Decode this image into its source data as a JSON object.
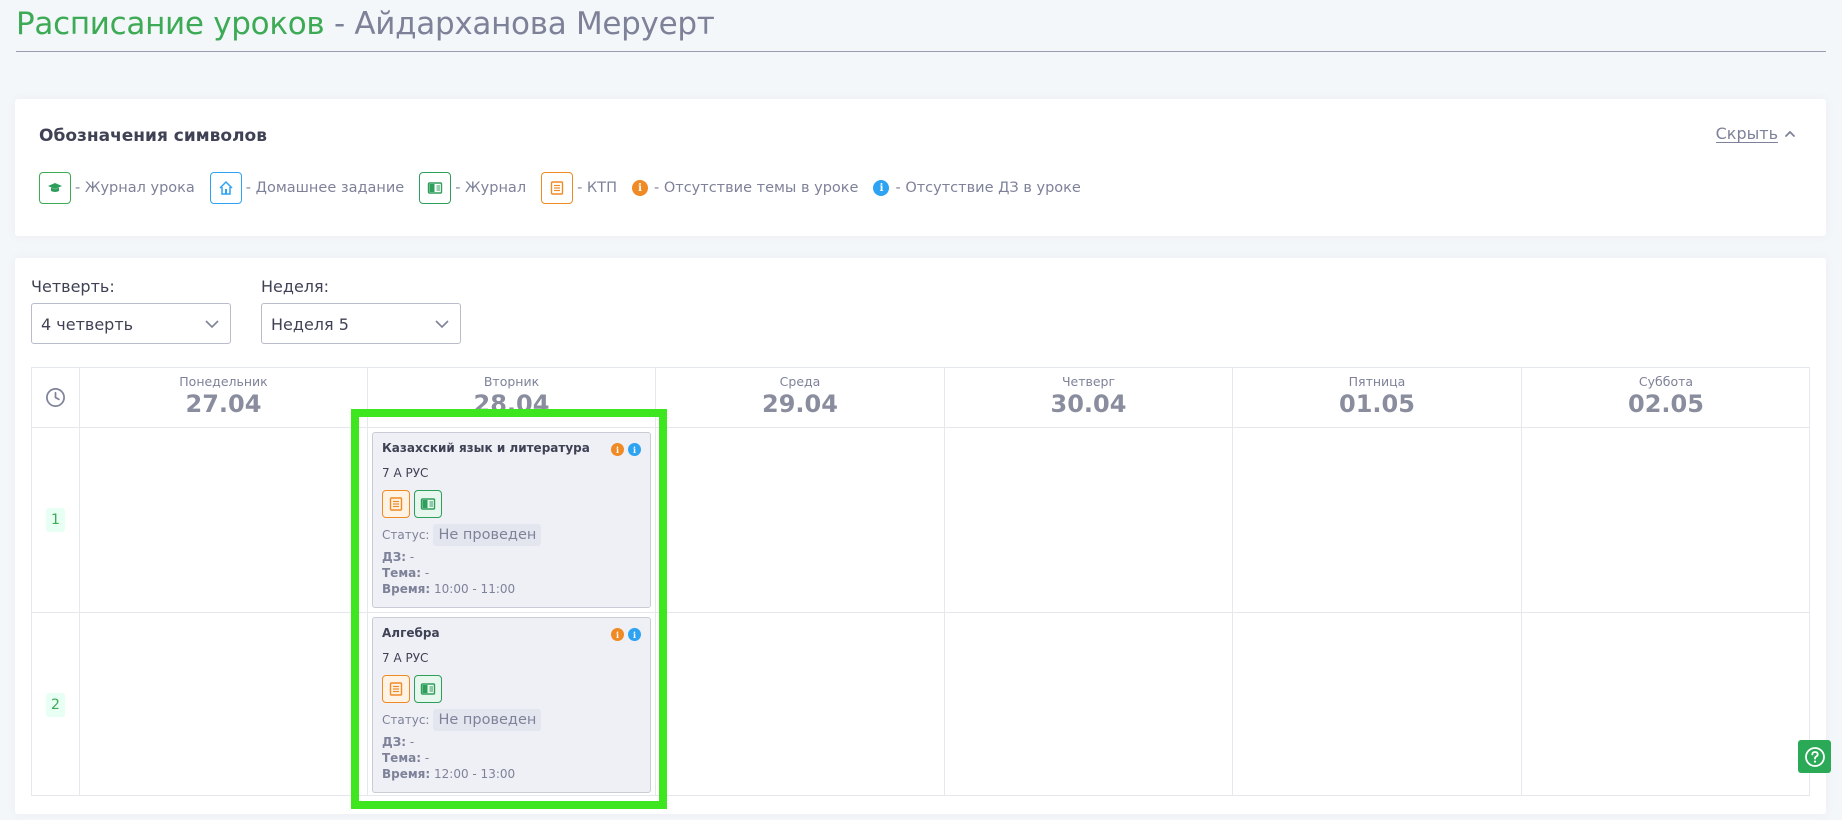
{
  "page": {
    "title_main": "Расписание уроков",
    "title_rest": " - Айдарханова Меруерт"
  },
  "legend": {
    "title": "Обозначения символов",
    "hide_label": "Скрыть",
    "items": {
      "lesson_journal": "- Журнал урока",
      "homework": "- Домашнее задание",
      "journal": "- Журнал",
      "ktp": "- КТП",
      "no_topic": "- Отсутствие темы в уроке",
      "no_hw": "- Отсутствие ДЗ в уроке"
    }
  },
  "filters": {
    "quarter_label": "Четверть:",
    "quarter_value": "4 четверть",
    "week_label": "Неделя:",
    "week_value": "Неделя 5"
  },
  "days": [
    {
      "name": "Понедельник",
      "date": "27.04"
    },
    {
      "name": "Вторник",
      "date": "28.04"
    },
    {
      "name": "Среда",
      "date": "29.04"
    },
    {
      "name": "Четверг",
      "date": "30.04"
    },
    {
      "name": "Пятница",
      "date": "01.05"
    },
    {
      "name": "Суббота",
      "date": "02.05"
    }
  ],
  "periods": [
    "1",
    "2"
  ],
  "lessons": [
    {
      "subject": "Казахский язык и литература",
      "class": "7 А РУС",
      "status_label": "Статус:",
      "status": "Не проведен",
      "hw_label": "ДЗ:",
      "hw": "-",
      "topic_label": "Тема:",
      "topic": "-",
      "time_label": "Время:",
      "time": "10:00 - 11:00"
    },
    {
      "subject": "Алгебра",
      "class": "7 А РУС",
      "status_label": "Статус:",
      "status": "Не проведен",
      "hw_label": "ДЗ:",
      "hw": "-",
      "topic_label": "Тема:",
      "topic": "-",
      "time_label": "Время:",
      "time": "12:00 - 13:00"
    }
  ],
  "colors": {
    "brand_green": "#3daa55",
    "orange": "#f08a24",
    "blue": "#2ea3f2",
    "highlight": "#3de61e"
  }
}
